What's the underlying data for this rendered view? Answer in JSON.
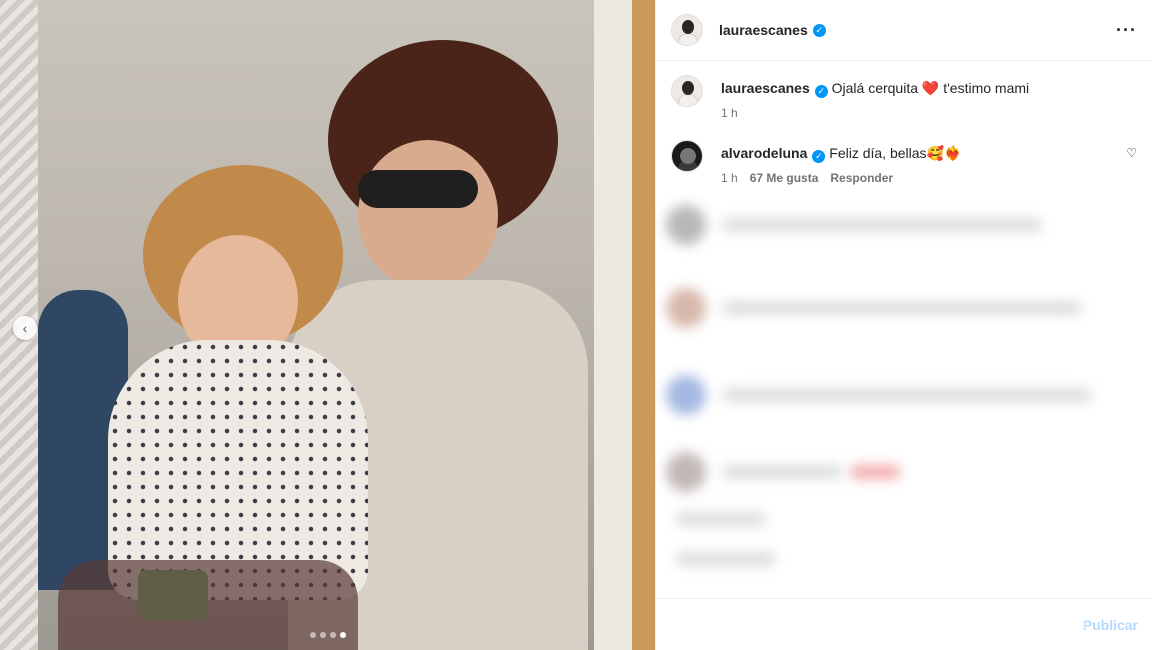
{
  "post": {
    "author": "lauraescanes",
    "carousel": {
      "total": 4,
      "active": 4
    }
  },
  "caption": {
    "author": "lauraescanes",
    "text": "Ojalá cerquita ❤️ t'estimo mami",
    "time": "1 h"
  },
  "comments": [
    {
      "author": "alvarodeluna",
      "text": "Feliz día, bellas🥰❤️‍🔥",
      "time": "1 h",
      "likes": "67 Me gusta",
      "reply_label": "Responder"
    }
  ],
  "composer": {
    "placeholder": "",
    "publish_label": "Publicar"
  },
  "colors": {
    "verified": "#0095f6",
    "publish_disabled": "#b3dbff",
    "text": "#262626",
    "muted": "#737373"
  },
  "icons": {
    "verified": "verified-badge-icon",
    "more": "more-options-icon",
    "like": "heart-icon",
    "prev": "chevron-left-icon"
  }
}
